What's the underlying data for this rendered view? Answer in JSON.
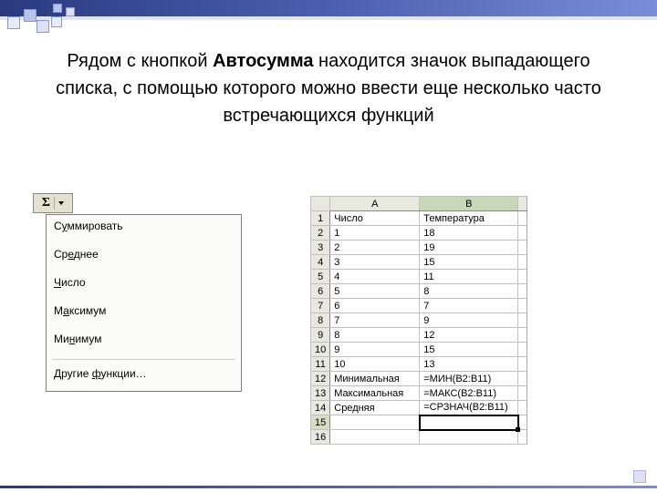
{
  "heading": {
    "p1_pre": "Рядом с кнопкой ",
    "p1_bold": "Автосумма",
    "p1_post": " находится значок выпадающего списка, с помощью которого можно ввести еще несколько часто встречающихся функций"
  },
  "autosum": {
    "symbol": "Σ"
  },
  "menu": [
    {
      "pre": "С",
      "u": "у",
      "post": "ммировать"
    },
    {
      "pre": "Ср",
      "u": "е",
      "post": "днее"
    },
    {
      "pre": "",
      "u": "Ч",
      "post": "исло"
    },
    {
      "pre": "М",
      "u": "а",
      "post": "ксимум"
    },
    {
      "pre": "Ми",
      "u": "н",
      "post": "имум"
    },
    {
      "sep": true
    },
    {
      "pre": "Другие ",
      "u": "ф",
      "post": "ункции…"
    }
  ],
  "sheet": {
    "cols": [
      "A",
      "B"
    ],
    "rows": [
      {
        "n": "1",
        "a": "Число",
        "b": "Температура"
      },
      {
        "n": "2",
        "a": "1",
        "b": "18"
      },
      {
        "n": "3",
        "a": "2",
        "b": "19"
      },
      {
        "n": "4",
        "a": "3",
        "b": "15"
      },
      {
        "n": "5",
        "a": "4",
        "b": "11"
      },
      {
        "n": "6",
        "a": "5",
        "b": "8"
      },
      {
        "n": "7",
        "a": "6",
        "b": "7"
      },
      {
        "n": "8",
        "a": "7",
        "b": "9"
      },
      {
        "n": "9",
        "a": "8",
        "b": "12"
      },
      {
        "n": "10",
        "a": "9",
        "b": "15"
      },
      {
        "n": "11",
        "a": "10",
        "b": "13"
      },
      {
        "n": "12",
        "a": "Минимальная",
        "b": "=МИН(B2:B11)"
      },
      {
        "n": "13",
        "a": "Максимальная",
        "b": "=МАКС(B2:B11)"
      },
      {
        "n": "14",
        "a": "Средняя",
        "b": "=СРЗНАЧ(B2:B11)"
      },
      {
        "n": "15",
        "a": "",
        "b": "",
        "sel": true
      },
      {
        "n": "16",
        "a": "",
        "b": ""
      }
    ]
  }
}
